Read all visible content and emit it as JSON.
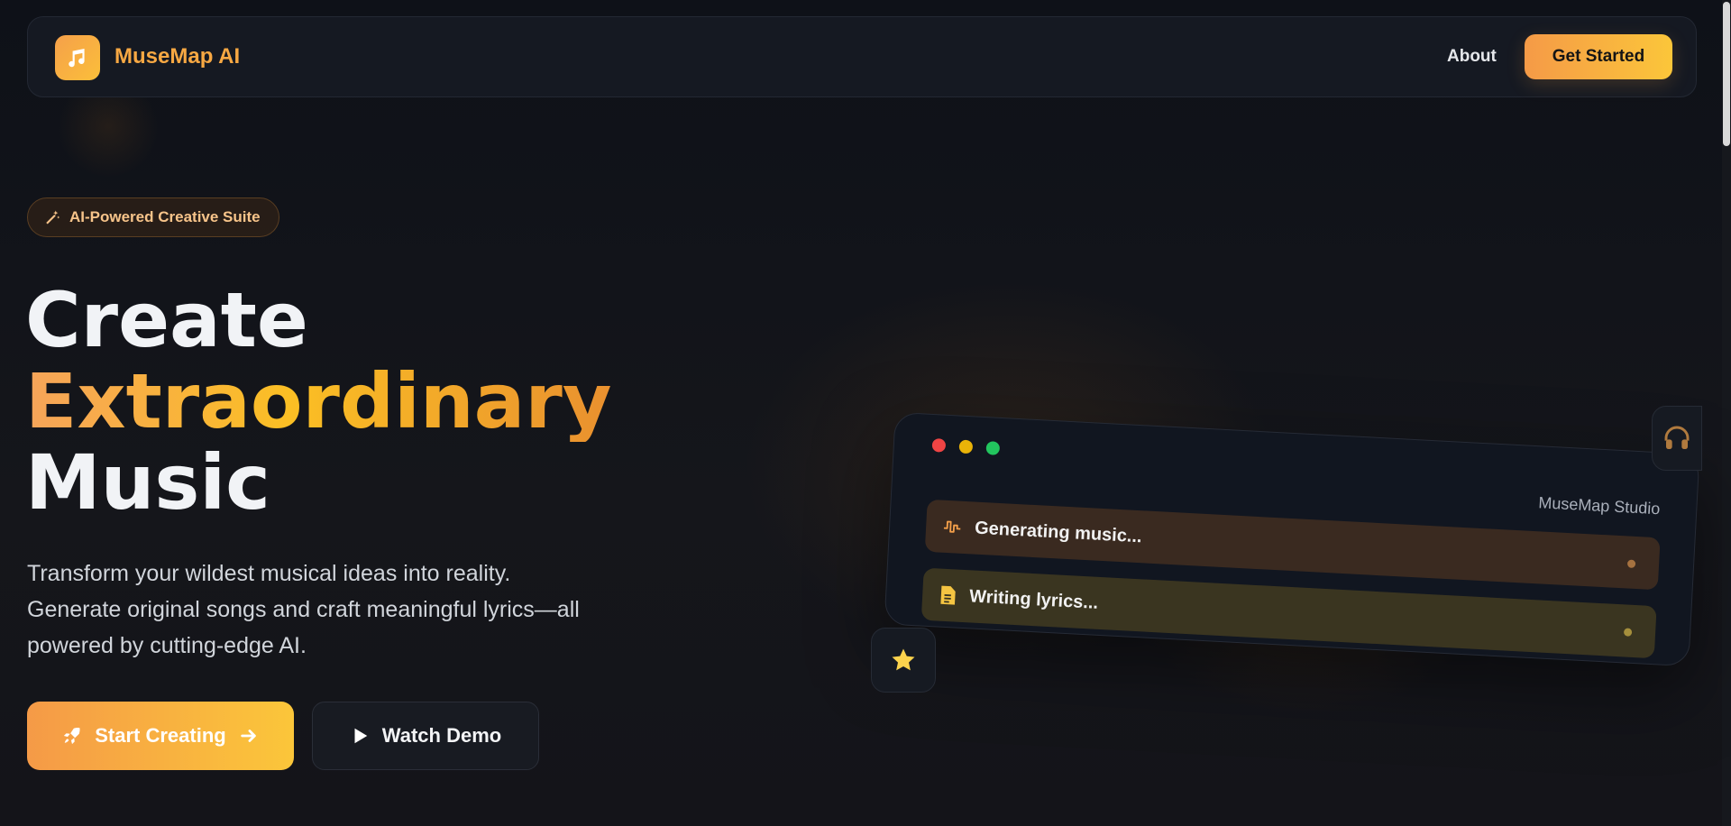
{
  "brand": {
    "name": "MuseMap AI",
    "icon": "music-note-icon",
    "accent": "#f7a843"
  },
  "nav": {
    "about": "About",
    "cta": "Get Started"
  },
  "hero": {
    "badge": {
      "label": "AI-Powered Creative Suite",
      "icon": "magic-wand-icon"
    },
    "headline": {
      "line1": "Create",
      "line2": "Extraordinary",
      "line3": "Music"
    },
    "description": "Transform your wildest musical ideas into reality. Generate original songs and craft meaningful lyrics—all powered by cutting-edge AI.",
    "primary_button": {
      "label": "Start Creating",
      "icon": "rocket-icon",
      "trailing_icon": "arrow-right-icon"
    },
    "secondary_button": {
      "label": "Watch Demo",
      "icon": "play-icon"
    }
  },
  "studio": {
    "title": "MuseMap Studio",
    "window_controls": [
      "#ef4444",
      "#eab308",
      "#22c55e"
    ],
    "tasks": [
      {
        "label": "Generating music...",
        "icon": "waveform-icon"
      },
      {
        "label": "Writing lyrics...",
        "icon": "document-icon"
      }
    ]
  },
  "floating": {
    "left_icon": "star-icon",
    "right_icon": "headphones-icon"
  },
  "colors": {
    "background": "#101218",
    "gradient_start": "#f59a47",
    "gradient_end": "#fbc63a"
  }
}
